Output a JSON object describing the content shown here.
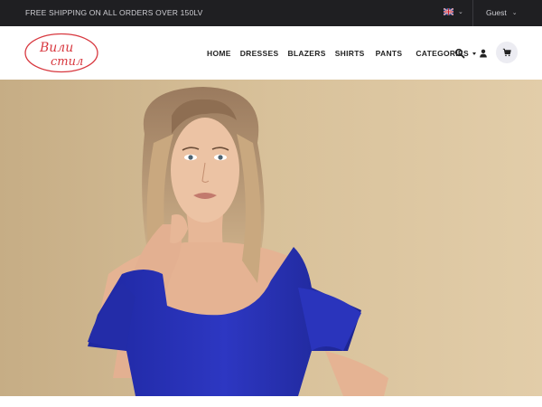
{
  "topbar": {
    "shipping_text": "FREE SHIPPING ON ALL ORDERS OVER 150LV",
    "language_icon": "uk-flag-icon",
    "account_label": "Guest",
    "background": "#1f1f22"
  },
  "header": {
    "logo_text": "Вили стил",
    "logo_color": "#d8383f",
    "nav": {
      "home": "HOME",
      "dresses": "DRESSES",
      "blazers": "BLAZERS",
      "shirts": "SHIRTS",
      "pants": "PANTS",
      "categories": "CATEGORIES"
    },
    "icons": [
      "search-icon",
      "user-icon",
      "cart-icon"
    ]
  },
  "hero": {
    "image": "model-in-blue-cold-shoulder-dress",
    "dress_color": "#2a33b8",
    "background_color": "#d9c29c"
  }
}
